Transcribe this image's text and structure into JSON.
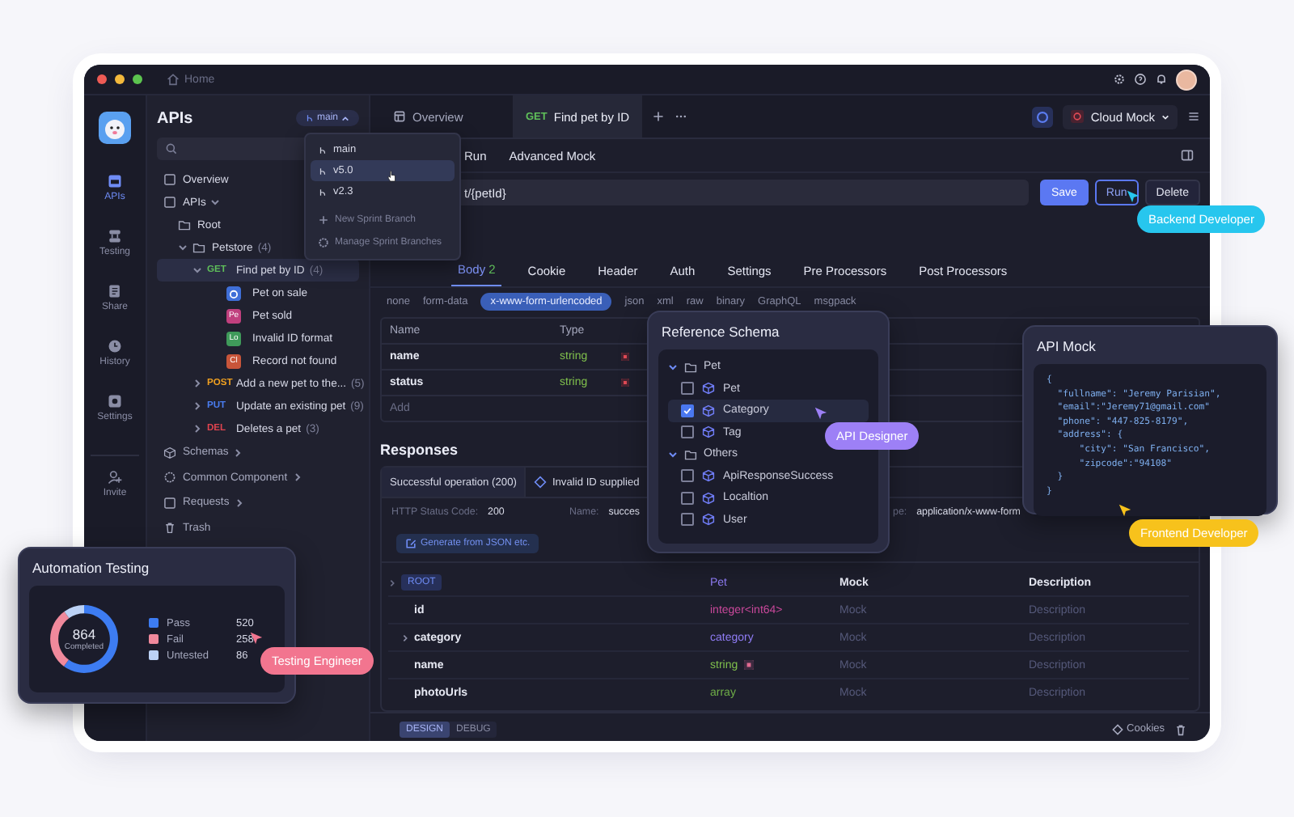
{
  "window": {
    "breadcrumb": "Home"
  },
  "rail": {
    "items": [
      {
        "kind": "apis",
        "label": "APIs",
        "selected": true
      },
      {
        "kind": "testing",
        "label": "Testing",
        "selected": false
      },
      {
        "kind": "share",
        "label": "Share",
        "selected": false
      },
      {
        "kind": "history",
        "label": "History",
        "selected": false
      },
      {
        "kind": "settings",
        "label": "Settings",
        "selected": false
      }
    ],
    "invite": "Invite"
  },
  "sidebar": {
    "title": "APIs",
    "branch": "main",
    "tree": [
      {
        "kind": "page",
        "label": "Overview"
      },
      {
        "kind": "module",
        "label": "APIs",
        "expanded": true,
        "children": [
          {
            "kind": "root",
            "label": "Root"
          },
          {
            "kind": "folder",
            "label": "Petstore",
            "count": "(4)",
            "expanded": true,
            "children": [
              {
                "kind": "endpoint",
                "method": "GET",
                "color": "#5fbf5a",
                "label": "Find pet by ID",
                "count": "(4)",
                "expanded": true,
                "selected": true,
                "children": [
                  {
                    "kind": "example",
                    "color": "#3f6fd8",
                    "label": "Pet on sale"
                  },
                  {
                    "kind": "example",
                    "badge": "Pe",
                    "color": "#c0407e",
                    "label": "Pet sold"
                  },
                  {
                    "kind": "example",
                    "badge": "Lo",
                    "color": "#3f9a5a",
                    "label": "Invalid ID format"
                  },
                  {
                    "kind": "example",
                    "badge": "Cl",
                    "color": "#c8553a",
                    "label": "Record not found"
                  }
                ]
              },
              {
                "kind": "endpoint",
                "method": "POST",
                "color": "#f0a020",
                "label": "Add a new pet to the...",
                "count": "(5)",
                "expanded": false,
                "selected": false
              },
              {
                "kind": "endpoint",
                "method": "PUT",
                "color": "#4a7df0",
                "label": "Update an existing pet",
                "count": "(9)",
                "expanded": false,
                "selected": false
              },
              {
                "kind": "endpoint",
                "method": "DEL",
                "color": "#e0444f",
                "label": "Deletes a pet",
                "count": "(3)",
                "expanded": false,
                "selected": false
              }
            ]
          }
        ]
      },
      {
        "kind": "schemas",
        "label": "Schemas",
        "expanded": false
      },
      {
        "kind": "components",
        "label": "Common Component",
        "expanded": false
      },
      {
        "kind": "requests",
        "label": "Requests",
        "expanded": false
      },
      {
        "kind": "trash",
        "label": "Trash"
      }
    ]
  },
  "branch_menu": {
    "branches": [
      {
        "label": "main",
        "selected": false
      },
      {
        "label": "v5.0",
        "selected": true
      },
      {
        "label": "v2.3",
        "selected": false
      }
    ],
    "actions": [
      {
        "kind": "new",
        "label": "New Sprint Branch"
      },
      {
        "kind": "manage",
        "label": "Manage Sprint Branches"
      }
    ]
  },
  "tabs": [
    {
      "kind": "overview",
      "label": "Overview",
      "selected": false
    },
    {
      "kind": "endpoint",
      "method": "GET",
      "label": "Find pet by ID",
      "selected": true
    }
  ],
  "environment": "Cloud Mock",
  "mode_tabs": [
    {
      "label": "Run",
      "selected": false
    },
    {
      "label": "Advanced Mock",
      "selected": false
    }
  ],
  "request": {
    "url": "t/{petId}",
    "buttons": [
      {
        "kind": "primary",
        "label": "Save"
      },
      {
        "kind": "outline",
        "label": "Run"
      },
      {
        "kind": "plain",
        "label": "Delete"
      }
    ]
  },
  "param_tabs": [
    {
      "label": "Body",
      "count": "2",
      "selected": true
    },
    {
      "label": "Cookie",
      "selected": false
    },
    {
      "label": "Header",
      "selected": false
    },
    {
      "label": "Auth",
      "selected": false
    },
    {
      "label": "Settings",
      "selected": false
    },
    {
      "label": "Pre Processors",
      "selected": false
    },
    {
      "label": "Post Processors",
      "selected": false
    }
  ],
  "body_types": [
    {
      "label": "none",
      "selected": false
    },
    {
      "label": "form-data",
      "selected": false
    },
    {
      "label": "x-www-form-urlencoded",
      "selected": true
    },
    {
      "label": "json",
      "selected": false
    },
    {
      "label": "xml",
      "selected": false
    },
    {
      "label": "raw",
      "selected": false
    },
    {
      "label": "binary",
      "selected": false
    },
    {
      "label": "GraphQL",
      "selected": false
    },
    {
      "label": "msgpack",
      "selected": false
    }
  ],
  "params": {
    "columns": [
      "Name",
      "Type"
    ],
    "rows": [
      {
        "name": "name",
        "type": "string",
        "required": true
      },
      {
        "name": "status",
        "type": "string",
        "required": true
      }
    ],
    "add": "Add"
  },
  "responses": {
    "title": "Responses",
    "tabs": [
      {
        "kind": "plain",
        "label": "Successful operation (200)",
        "selected": true
      },
      {
        "kind": "diamond",
        "label": "Invalid ID supplied",
        "selected": false
      }
    ],
    "info": [
      {
        "label": "HTTP Status Code:",
        "value": "200"
      },
      {
        "label": "Name:",
        "value": "succes"
      },
      {
        "label": "pe:",
        "value": "application/x-www-form"
      }
    ],
    "generate": "Generate from JSON etc.",
    "schema": {
      "root": "ROOT",
      "root_type": "Pet",
      "columns": [
        "Mock",
        "Description"
      ],
      "rows": [
        {
          "kind": "field",
          "name": "id",
          "type": "integer<int64>",
          "color": "#c8489a",
          "required": false,
          "mock": "Mock",
          "description": "Description"
        },
        {
          "kind": "object",
          "name": "category",
          "type": "category",
          "color": "#8f7cf4",
          "required": false,
          "mock": "Mock",
          "description": "Description"
        },
        {
          "kind": "field",
          "name": "name",
          "type": "string",
          "color": "#7fbf4c",
          "required": true,
          "mock": "Mock",
          "description": "Description"
        },
        {
          "kind": "field",
          "name": "photoUrls",
          "type": "array",
          "color": "#6fae48",
          "required": false,
          "mock": "Mock",
          "description": "Description"
        }
      ]
    }
  },
  "footer": {
    "modes": [
      {
        "label": "DESIGN",
        "selected": true
      },
      {
        "label": "DEBUG",
        "selected": false
      }
    ],
    "cookies": "Cookies"
  },
  "reference_schema": {
    "title": "Reference Schema",
    "groups": [
      {
        "label": "Pet",
        "expanded": true,
        "items": [
          {
            "label": "Pet",
            "checked": false
          },
          {
            "label": "Category",
            "checked": true
          },
          {
            "label": "Tag",
            "checked": false
          }
        ]
      },
      {
        "label": "Others",
        "expanded": true,
        "items": [
          {
            "label": "ApiResponseSuccess",
            "checked": false
          },
          {
            "label": "Localtion",
            "checked": false
          },
          {
            "label": "User",
            "checked": false
          }
        ]
      }
    ]
  },
  "api_mock": {
    "title": "API Mock",
    "code": [
      "{",
      "  \"fullname\": \"Jeremy Parisian\",",
      "  \"email\":\"Jeremy71@gmail.com\"",
      "  \"phone\": \"447-825-8179\",",
      "  \"address\": {",
      "      \"city\": \"San Francisco\",",
      "      \"zipcode\":\"94108\"",
      "  }",
      "}"
    ]
  },
  "automation": {
    "title": "Automation Testing",
    "total": "864",
    "total_label": "Completed",
    "legend": [
      {
        "value": "520",
        "color": "#3d7cf2"
      },
      {
        "value": "258",
        "color": "#f0899c"
      },
      {
        "value": "86",
        "color": "#bcd2f6"
      }
    ],
    "chart_data": {
      "type": "donut",
      "categories": [
        "Pass",
        "Fail",
        "Untested"
      ],
      "values": [
        60.19,
        29.86,
        9.95
      ]
    }
  },
  "callouts": [
    {
      "label": "Backend Developer",
      "color": "#27c6ee"
    },
    {
      "label": "API Designer",
      "color": "#9d80f6"
    },
    {
      "label": "Frontend Developer",
      "color": "#f7c21c"
    },
    {
      "label": "Testing Engineer",
      "color": "#f2758f"
    }
  ]
}
